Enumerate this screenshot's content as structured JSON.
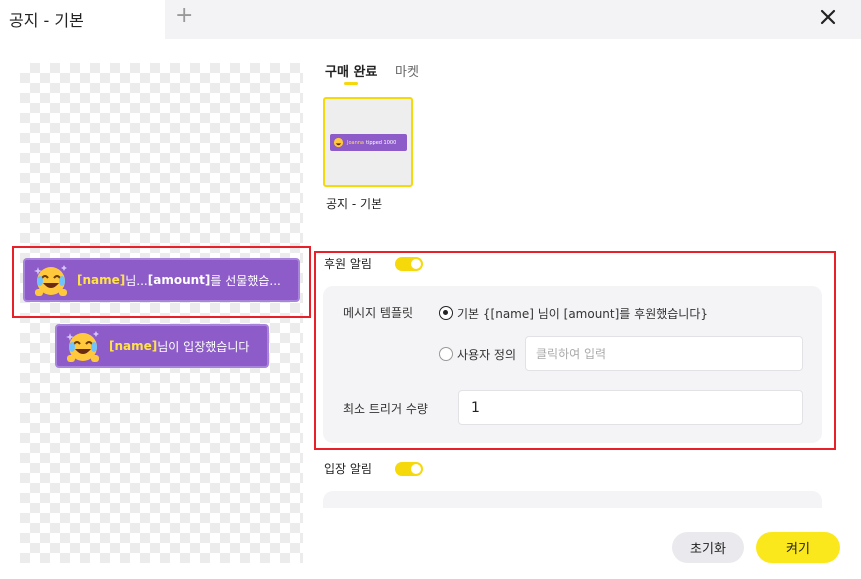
{
  "tab": {
    "title": "공지 - 기본",
    "add_symbol": "+"
  },
  "preview": {
    "notice1": {
      "name": "[name]",
      "text1": " 님... ",
      "amount": "[amount]",
      "text2": " 를 선물했습..."
    },
    "notice2": {
      "name": "[name]",
      "text": " 님이 입장했습니다"
    }
  },
  "subtabs": [
    "구매 완료",
    "마켓"
  ],
  "template_card": {
    "thumb_name": "Joanna",
    "thumb_text": "tipped 1000",
    "label": "공지 - 기본"
  },
  "donation": {
    "label": "후원 알림",
    "enabled": true,
    "message_template_label": "메시지 템플릿",
    "option_default": "기본 {[name] 님이 [amount]를 후원했습니다}",
    "option_custom": "사용자 정의",
    "custom_placeholder": "클릭하여 입력",
    "min_trigger_label": "최소 트리거 수량",
    "min_trigger_value": "1"
  },
  "entrance": {
    "label": "입장 알림",
    "enabled": true
  },
  "buttons": {
    "reset": "초기화",
    "turn_on": "켜기"
  },
  "colors": {
    "accent": "#f5d90a",
    "notice_bg": "#8d5cc8",
    "highlight": "#e8202a"
  }
}
